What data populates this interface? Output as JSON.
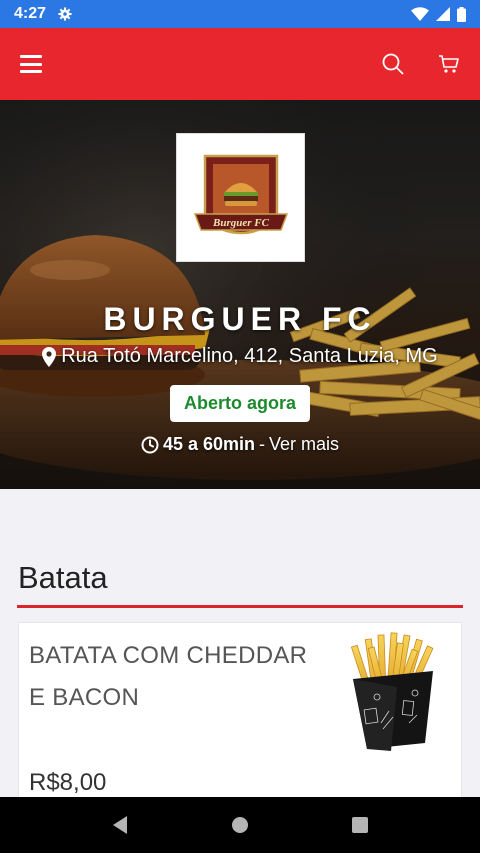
{
  "status_bar": {
    "time": "4:27",
    "icons": [
      "gear-icon",
      "wifi-icon",
      "signal-icon",
      "battery-icon"
    ],
    "bg_color": "#2b78e4"
  },
  "app_bar": {
    "bg_color": "#e8262e",
    "icons": [
      "menu-icon",
      "search-icon",
      "cart-icon"
    ]
  },
  "store": {
    "logo_text": "Burguer FC",
    "name": "BURGUER FC",
    "address": "Rua Totó Marcelino, 412, Santa Luzia, MG",
    "status": "Aberto agora",
    "status_color": "#1e8a2e",
    "delivery_time": "45 a 60min",
    "delivery_separator": "-",
    "see_more": "Ver mais"
  },
  "menu": {
    "section_title": "Batata",
    "accent_color": "#d9252b",
    "products": [
      {
        "name": "BATATA COM CHEDDAR E BACON",
        "price": "R$8,00"
      }
    ]
  },
  "nav_bar": {
    "icons": [
      "back-icon",
      "home-icon",
      "recents-icon"
    ]
  }
}
